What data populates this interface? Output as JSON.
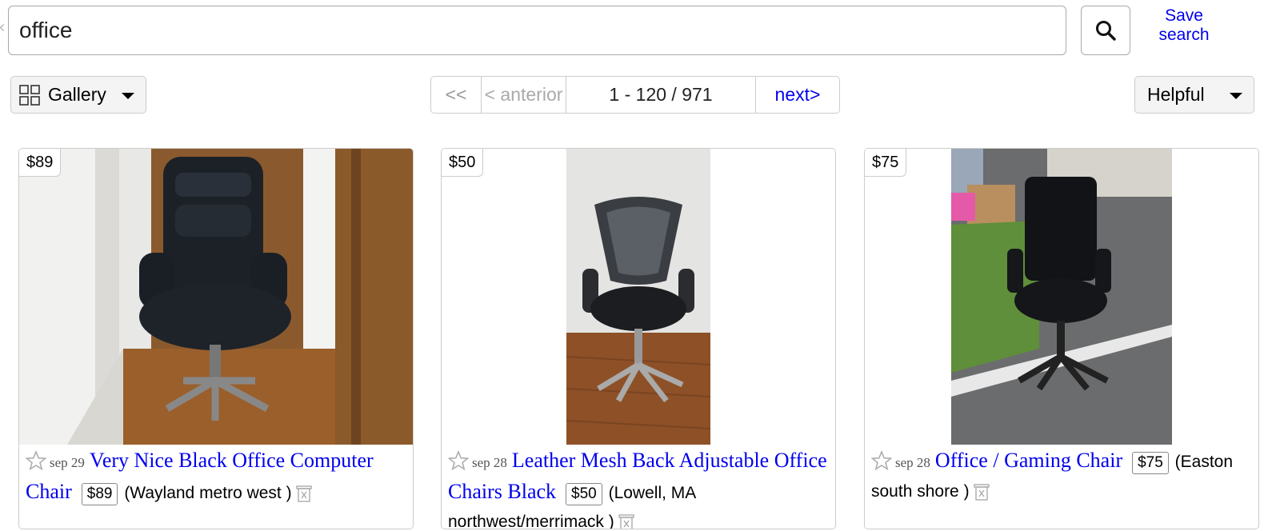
{
  "search": {
    "query": "office",
    "save_label_line1": "Save",
    "save_label_line2": "search"
  },
  "controls": {
    "view_label": "Gallery",
    "pager": {
      "first": "<<",
      "prev": "< anterior",
      "range": "1 - 120 / 971",
      "next": "next>"
    },
    "sort_label": "Helpful"
  },
  "listings": [
    {
      "price": "$89",
      "date": "sep 29",
      "title": "Very Nice Black Office Computer Chair",
      "location": "(Wayland metro west )"
    },
    {
      "price": "$50",
      "date": "sep 28",
      "title": "Leather Mesh Back Adjustable Office Chairs Black",
      "location": "(Lowell, MA northwest/merrimack )"
    },
    {
      "price": "$75",
      "date": "sep 28",
      "title": "Office / Gaming Chair",
      "location": "(Easton south shore )"
    }
  ],
  "colors": {
    "link": "#0000ee",
    "border": "#cccccc"
  }
}
